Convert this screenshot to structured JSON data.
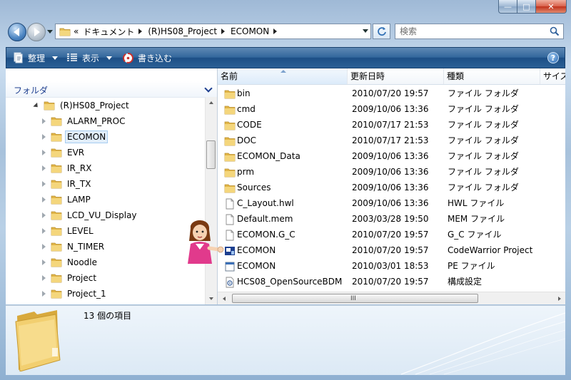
{
  "window": {
    "caption_glyphs": {
      "minimize": "—",
      "maximize": "□",
      "close": "✕"
    }
  },
  "address": {
    "overflow": "«",
    "breadcrumbs": [
      "ドキュメント",
      "(R)HS08_Project",
      "ECOMON"
    ]
  },
  "search": {
    "placeholder": "検索"
  },
  "toolbar": {
    "organize_label": "整理",
    "views_label": "表示",
    "burn_label": "書き込む",
    "help_label": "?"
  },
  "nav_pane": {
    "title": "フォルダ",
    "tree": [
      {
        "label": "(R)HS08_Project",
        "level": 0,
        "expanded": true
      },
      {
        "label": "ALARM_PROC",
        "level": 1
      },
      {
        "label": "ECOMON",
        "level": 1,
        "selected": true
      },
      {
        "label": "EVR",
        "level": 1
      },
      {
        "label": "IR_RX",
        "level": 1
      },
      {
        "label": "IR_TX",
        "level": 1
      },
      {
        "label": "LAMP",
        "level": 1
      },
      {
        "label": "LCD_VU_Display",
        "level": 1
      },
      {
        "label": "LEVEL",
        "level": 1
      },
      {
        "label": "N_TIMER",
        "level": 1
      },
      {
        "label": "Noodle",
        "level": 1
      },
      {
        "label": "Project",
        "level": 1
      },
      {
        "label": "Project_1",
        "level": 1
      }
    ]
  },
  "file_list": {
    "columns": {
      "name": "名前",
      "date": "更新日時",
      "type": "種類",
      "size": "サイズ"
    },
    "scroll_grip": "III",
    "rows": [
      {
        "icon": "folder-icon",
        "name": "bin",
        "date": "2010/07/20 19:57",
        "type": "ファイル フォルダ"
      },
      {
        "icon": "folder-icon",
        "name": "cmd",
        "date": "2009/10/06 13:36",
        "type": "ファイル フォルダ"
      },
      {
        "icon": "folder-icon",
        "name": "CODE",
        "date": "2010/07/17 21:53",
        "type": "ファイル フォルダ"
      },
      {
        "icon": "folder-icon",
        "name": "DOC",
        "date": "2010/07/17 21:53",
        "type": "ファイル フォルダ"
      },
      {
        "icon": "folder-icon",
        "name": "ECOMON_Data",
        "date": "2009/10/06 13:36",
        "type": "ファイル フォルダ"
      },
      {
        "icon": "folder-icon",
        "name": "prm",
        "date": "2009/10/06 13:36",
        "type": "ファイル フォルダ"
      },
      {
        "icon": "folder-icon",
        "name": "Sources",
        "date": "2009/10/06 13:36",
        "type": "ファイル フォルダ"
      },
      {
        "icon": "file-icon",
        "name": "C_Layout.hwl",
        "date": "2009/10/06 13:36",
        "type": "HWL ファイル"
      },
      {
        "icon": "file-icon",
        "name": "Default.mem",
        "date": "2003/03/28 19:50",
        "type": "MEM ファイル"
      },
      {
        "icon": "file-icon",
        "name": "ECOMON.G_C",
        "date": "2010/07/20 19:57",
        "type": "G_C ファイル"
      },
      {
        "icon": "codewarrior-project-icon",
        "name": "ECOMON",
        "date": "2010/07/20 19:57",
        "type": "CodeWarrior Project"
      },
      {
        "icon": "executable-icon",
        "name": "ECOMON",
        "date": "2010/03/01 18:53",
        "type": "PE ファイル"
      },
      {
        "icon": "config-icon",
        "name": "HCS08_OpenSourceBDM",
        "date": "2010/07/20 19:57",
        "type": "構成設定"
      }
    ]
  },
  "details": {
    "item_count": "13 個の項目"
  },
  "colors": {
    "toolbar": "#2a5f95",
    "folder": "#e8c25a",
    "selection": "#e2eefb",
    "nav_title": "#1e3f8f"
  }
}
